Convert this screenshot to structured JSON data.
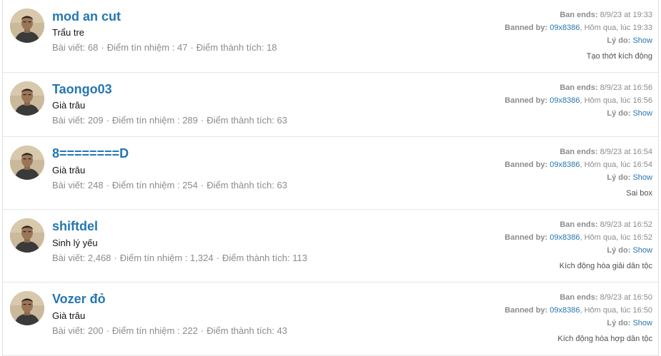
{
  "labels": {
    "ban_ends": "Ban ends:",
    "banned_by": "Banned by:",
    "reason": "Lý do:",
    "show": "Show",
    "posts": "Bài viết:",
    "trust": "Điểm tín nhiệm :",
    "achievement": "Điểm thành tích:"
  },
  "bans": [
    {
      "name": "mod an cut",
      "title": "Trẩu tre",
      "posts": "68",
      "trust": "47",
      "achievement": "18",
      "ban_ends": "8/9/23 at 19:33",
      "banned_by": "09x8386",
      "banned_when": ", Hôm qua, lúc 19:33",
      "reason_text": "Tạo thớt kích động"
    },
    {
      "name": "Taongo03",
      "title": "Già trâu",
      "posts": "209",
      "trust": "289",
      "achievement": "63",
      "ban_ends": "8/9/23 at 16:56",
      "banned_by": "09x8386",
      "banned_when": ", Hôm qua, lúc 16:56",
      "reason_text": ""
    },
    {
      "name": "8========D",
      "title": "Già trâu",
      "posts": "248",
      "trust": "254",
      "achievement": "63",
      "ban_ends": "8/9/23 at 16:54",
      "banned_by": "09x8386",
      "banned_when": ", Hôm qua, lúc 16:54",
      "reason_text": "Sai box"
    },
    {
      "name": "shiftdel",
      "title": "Sinh lý yếu",
      "posts": "2,468",
      "trust": "1,324",
      "achievement": "113",
      "ban_ends": "8/9/23 at 16:52",
      "banned_by": "09x8386",
      "banned_when": ", Hôm qua, lúc 16:52",
      "reason_text": "Kích động hòa giải dân tộc"
    },
    {
      "name": "Vozer đỏ",
      "title": "Già trâu",
      "posts": "200",
      "trust": "222",
      "achievement": "43",
      "ban_ends": "8/9/23 at 16:50",
      "banned_by": "09x8386",
      "banned_when": ", Hôm qua, lúc 16:50",
      "reason_text": "Kích động hòa hợp dân tộc"
    }
  ]
}
